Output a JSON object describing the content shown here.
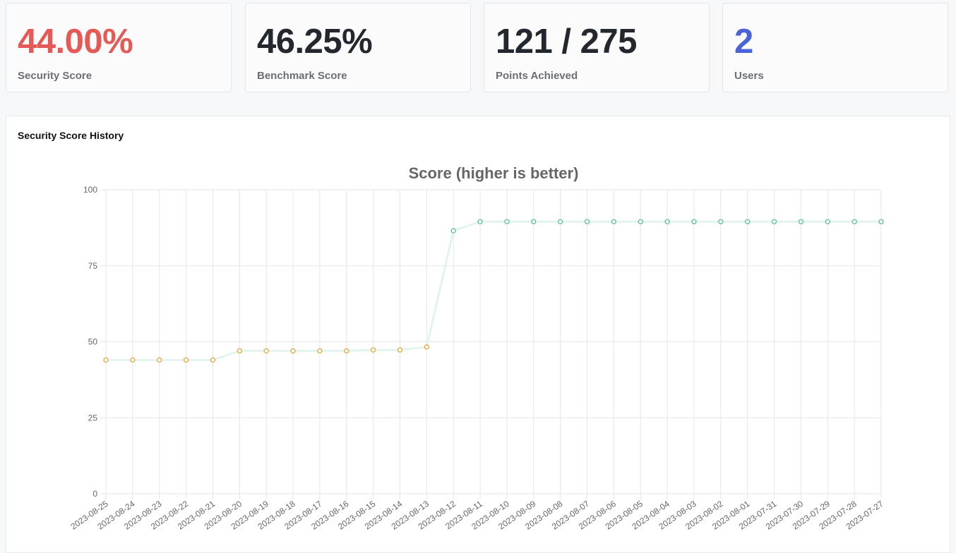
{
  "stats": [
    {
      "value": "44.00%",
      "label": "Security Score",
      "color": "#e55a55"
    },
    {
      "value": "46.25%",
      "label": "Benchmark Score",
      "color": "#23272e"
    },
    {
      "value": "121 / 275",
      "label": "Points Achieved",
      "color": "#23272e"
    },
    {
      "value": "2",
      "label": "Users",
      "color": "#4a63d8"
    }
  ],
  "panel": {
    "title": "Security Score History"
  },
  "colors": {
    "line": "#e3f3ee",
    "low_point": "#e6a83a",
    "high_point": "#5cbf9a",
    "grid": "#e6e6e6",
    "axis_text": "#666666",
    "title_text": "#666666"
  },
  "chart_data": {
    "type": "line",
    "title": "Score (higher is better)",
    "xlabel": "",
    "ylabel": "",
    "ylim": [
      0,
      100
    ],
    "yticks": [
      0,
      25,
      50,
      75,
      100
    ],
    "grid": true,
    "categories": [
      "2023-08-25",
      "2023-08-24",
      "2023-08-23",
      "2023-08-22",
      "2023-08-21",
      "2023-08-20",
      "2023-08-19",
      "2023-08-18",
      "2023-08-17",
      "2023-08-16",
      "2023-08-15",
      "2023-08-14",
      "2023-08-13",
      "2023-08-12",
      "2023-08-11",
      "2023-08-10",
      "2023-08-09",
      "2023-08-08",
      "2023-08-07",
      "2023-08-06",
      "2023-08-05",
      "2023-08-04",
      "2023-08-03",
      "2023-08-02",
      "2023-08-01",
      "2023-07-31",
      "2023-07-30",
      "2023-07-29",
      "2023-07-28",
      "2023-07-27"
    ],
    "series": [
      {
        "values": [
          44,
          44,
          44,
          44,
          44,
          47,
          47,
          47,
          47,
          47,
          47.3,
          47.3,
          48.3,
          86.5,
          89.5,
          89.5,
          89.5,
          89.5,
          89.5,
          89.5,
          89.5,
          89.5,
          89.5,
          89.5,
          89.5,
          89.5,
          89.5,
          89.5,
          89.5,
          89.5
        ]
      }
    ]
  }
}
